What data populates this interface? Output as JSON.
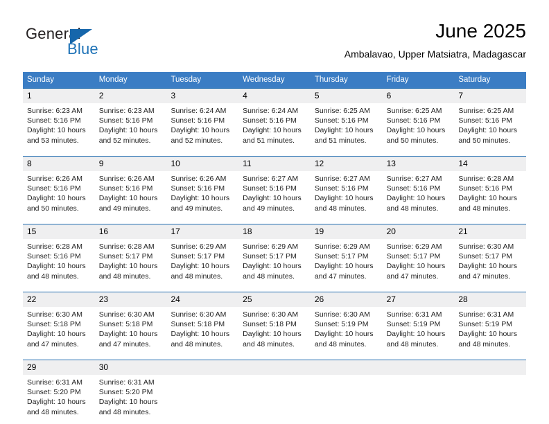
{
  "brand": {
    "name_part1": "General",
    "name_part2": "Blue",
    "triangle_color": "#1666ab",
    "blue_text_color": "#1f73b7"
  },
  "header": {
    "title": "June 2025",
    "subtitle": "Ambalavao, Upper Matsiatra, Madagascar"
  },
  "theme": {
    "header_bg": "#3b7dc4",
    "week_divider": "#1f6cb0",
    "day_band_bg": "#efeff0"
  },
  "weekdays": [
    "Sunday",
    "Monday",
    "Tuesday",
    "Wednesday",
    "Thursday",
    "Friday",
    "Saturday"
  ],
  "weeks": [
    [
      {
        "day": "1",
        "sunrise": "Sunrise: 6:23 AM",
        "sunset": "Sunset: 5:16 PM",
        "daylight": "Daylight: 10 hours and 53 minutes."
      },
      {
        "day": "2",
        "sunrise": "Sunrise: 6:23 AM",
        "sunset": "Sunset: 5:16 PM",
        "daylight": "Daylight: 10 hours and 52 minutes."
      },
      {
        "day": "3",
        "sunrise": "Sunrise: 6:24 AM",
        "sunset": "Sunset: 5:16 PM",
        "daylight": "Daylight: 10 hours and 52 minutes."
      },
      {
        "day": "4",
        "sunrise": "Sunrise: 6:24 AM",
        "sunset": "Sunset: 5:16 PM",
        "daylight": "Daylight: 10 hours and 51 minutes."
      },
      {
        "day": "5",
        "sunrise": "Sunrise: 6:25 AM",
        "sunset": "Sunset: 5:16 PM",
        "daylight": "Daylight: 10 hours and 51 minutes."
      },
      {
        "day": "6",
        "sunrise": "Sunrise: 6:25 AM",
        "sunset": "Sunset: 5:16 PM",
        "daylight": "Daylight: 10 hours and 50 minutes."
      },
      {
        "day": "7",
        "sunrise": "Sunrise: 6:25 AM",
        "sunset": "Sunset: 5:16 PM",
        "daylight": "Daylight: 10 hours and 50 minutes."
      }
    ],
    [
      {
        "day": "8",
        "sunrise": "Sunrise: 6:26 AM",
        "sunset": "Sunset: 5:16 PM",
        "daylight": "Daylight: 10 hours and 50 minutes."
      },
      {
        "day": "9",
        "sunrise": "Sunrise: 6:26 AM",
        "sunset": "Sunset: 5:16 PM",
        "daylight": "Daylight: 10 hours and 49 minutes."
      },
      {
        "day": "10",
        "sunrise": "Sunrise: 6:26 AM",
        "sunset": "Sunset: 5:16 PM",
        "daylight": "Daylight: 10 hours and 49 minutes."
      },
      {
        "day": "11",
        "sunrise": "Sunrise: 6:27 AM",
        "sunset": "Sunset: 5:16 PM",
        "daylight": "Daylight: 10 hours and 49 minutes."
      },
      {
        "day": "12",
        "sunrise": "Sunrise: 6:27 AM",
        "sunset": "Sunset: 5:16 PM",
        "daylight": "Daylight: 10 hours and 48 minutes."
      },
      {
        "day": "13",
        "sunrise": "Sunrise: 6:27 AM",
        "sunset": "Sunset: 5:16 PM",
        "daylight": "Daylight: 10 hours and 48 minutes."
      },
      {
        "day": "14",
        "sunrise": "Sunrise: 6:28 AM",
        "sunset": "Sunset: 5:16 PM",
        "daylight": "Daylight: 10 hours and 48 minutes."
      }
    ],
    [
      {
        "day": "15",
        "sunrise": "Sunrise: 6:28 AM",
        "sunset": "Sunset: 5:16 PM",
        "daylight": "Daylight: 10 hours and 48 minutes."
      },
      {
        "day": "16",
        "sunrise": "Sunrise: 6:28 AM",
        "sunset": "Sunset: 5:17 PM",
        "daylight": "Daylight: 10 hours and 48 minutes."
      },
      {
        "day": "17",
        "sunrise": "Sunrise: 6:29 AM",
        "sunset": "Sunset: 5:17 PM",
        "daylight": "Daylight: 10 hours and 48 minutes."
      },
      {
        "day": "18",
        "sunrise": "Sunrise: 6:29 AM",
        "sunset": "Sunset: 5:17 PM",
        "daylight": "Daylight: 10 hours and 48 minutes."
      },
      {
        "day": "19",
        "sunrise": "Sunrise: 6:29 AM",
        "sunset": "Sunset: 5:17 PM",
        "daylight": "Daylight: 10 hours and 47 minutes."
      },
      {
        "day": "20",
        "sunrise": "Sunrise: 6:29 AM",
        "sunset": "Sunset: 5:17 PM",
        "daylight": "Daylight: 10 hours and 47 minutes."
      },
      {
        "day": "21",
        "sunrise": "Sunrise: 6:30 AM",
        "sunset": "Sunset: 5:17 PM",
        "daylight": "Daylight: 10 hours and 47 minutes."
      }
    ],
    [
      {
        "day": "22",
        "sunrise": "Sunrise: 6:30 AM",
        "sunset": "Sunset: 5:18 PM",
        "daylight": "Daylight: 10 hours and 47 minutes."
      },
      {
        "day": "23",
        "sunrise": "Sunrise: 6:30 AM",
        "sunset": "Sunset: 5:18 PM",
        "daylight": "Daylight: 10 hours and 47 minutes."
      },
      {
        "day": "24",
        "sunrise": "Sunrise: 6:30 AM",
        "sunset": "Sunset: 5:18 PM",
        "daylight": "Daylight: 10 hours and 48 minutes."
      },
      {
        "day": "25",
        "sunrise": "Sunrise: 6:30 AM",
        "sunset": "Sunset: 5:18 PM",
        "daylight": "Daylight: 10 hours and 48 minutes."
      },
      {
        "day": "26",
        "sunrise": "Sunrise: 6:30 AM",
        "sunset": "Sunset: 5:19 PM",
        "daylight": "Daylight: 10 hours and 48 minutes."
      },
      {
        "day": "27",
        "sunrise": "Sunrise: 6:31 AM",
        "sunset": "Sunset: 5:19 PM",
        "daylight": "Daylight: 10 hours and 48 minutes."
      },
      {
        "day": "28",
        "sunrise": "Sunrise: 6:31 AM",
        "sunset": "Sunset: 5:19 PM",
        "daylight": "Daylight: 10 hours and 48 minutes."
      }
    ],
    [
      {
        "day": "29",
        "sunrise": "Sunrise: 6:31 AM",
        "sunset": "Sunset: 5:20 PM",
        "daylight": "Daylight: 10 hours and 48 minutes."
      },
      {
        "day": "30",
        "sunrise": "Sunrise: 6:31 AM",
        "sunset": "Sunset: 5:20 PM",
        "daylight": "Daylight: 10 hours and 48 minutes."
      },
      {
        "day": "",
        "sunrise": "",
        "sunset": "",
        "daylight": ""
      },
      {
        "day": "",
        "sunrise": "",
        "sunset": "",
        "daylight": ""
      },
      {
        "day": "",
        "sunrise": "",
        "sunset": "",
        "daylight": ""
      },
      {
        "day": "",
        "sunrise": "",
        "sunset": "",
        "daylight": ""
      },
      {
        "day": "",
        "sunrise": "",
        "sunset": "",
        "daylight": ""
      }
    ]
  ]
}
